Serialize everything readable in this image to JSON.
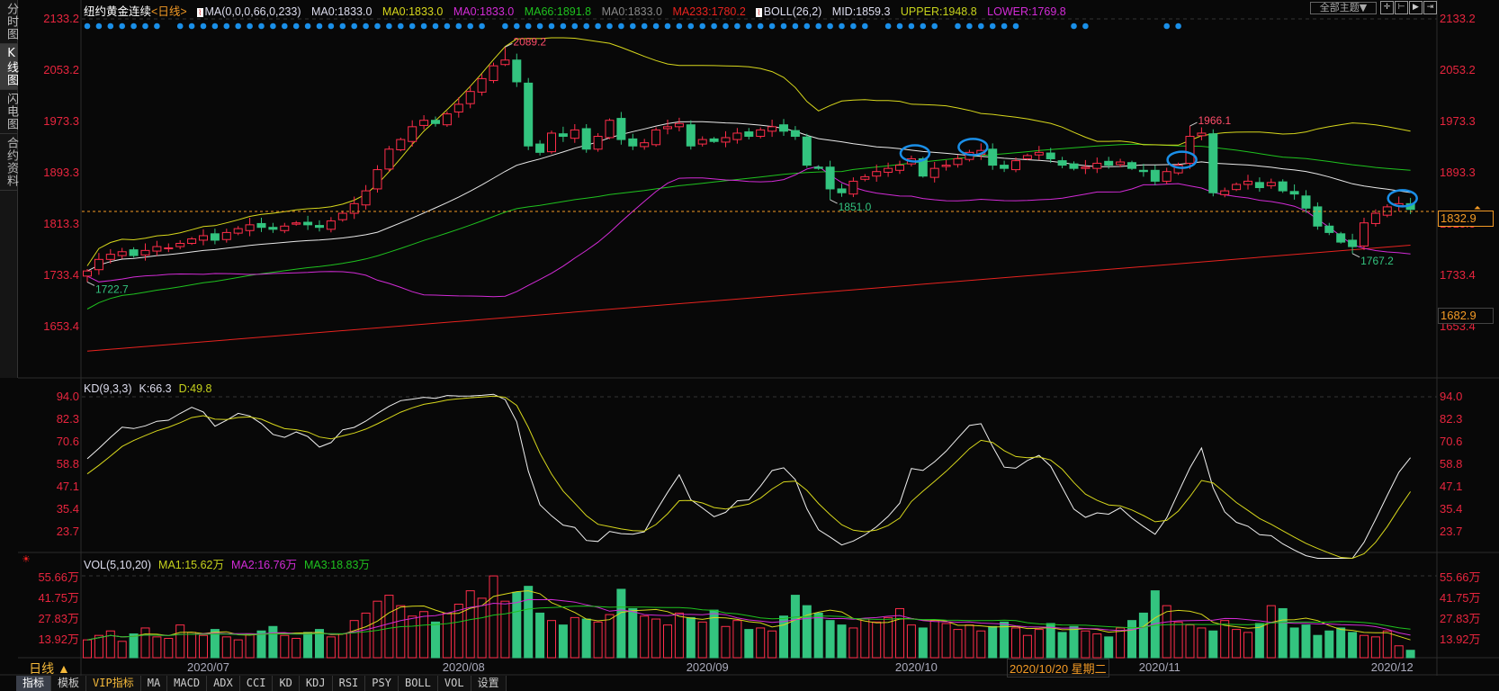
{
  "sidebar": {
    "tabs": [
      "分时图",
      "K线图",
      "闪电图",
      "合约资料"
    ],
    "active": 1
  },
  "header": {
    "title": "纽约黄金连续",
    "period": "<日线>",
    "ma_params": "MA(0,0,0,66,0,233)",
    "ma0_white": "MA0:1833.0",
    "ma0_yellow": "MA0:1833.0",
    "ma0_magenta": "MA0:1833.0",
    "ma66": "MA66:1891.8",
    "ma0_grey": "MA0:1833.0",
    "ma233": "MA233:1780.2",
    "boll": "BOLL(26,2)",
    "mid": "MID:1859.3",
    "upper": "UPPER:1948.8",
    "lower": "LOWER:1769.8"
  },
  "topright": {
    "theme_button": "全部主题▼"
  },
  "price_axis": {
    "labels": [
      "2133.2",
      "2053.2",
      "1973.3",
      "1893.3",
      "1813.3",
      "1733.4",
      "1653.4"
    ],
    "current_price": "1832.9",
    "cursor_price": "1682.9"
  },
  "kd": {
    "header": "KD(9,3,3)",
    "k": "K:66.3",
    "d": "D:49.8",
    "labels": [
      "94.0",
      "82.3",
      "70.6",
      "58.8",
      "47.1",
      "35.4",
      "23.7"
    ]
  },
  "vol": {
    "header": "VOL(5,10,20)",
    "ma1": "MA1:15.62万",
    "ma2": "MA2:16.76万",
    "ma3": "MA3:18.83万",
    "labels": [
      "55.66万",
      "41.75万",
      "27.83万",
      "13.92万"
    ]
  },
  "dates": {
    "labels": [
      "2020/07",
      "2020/08",
      "2020/09",
      "2020/10",
      "2020/11",
      "2020/12"
    ],
    "label_index": [
      10,
      32,
      53,
      71,
      92,
      112
    ],
    "cursor": "2020/10/20 星期二"
  },
  "bottom": {
    "period": "日线 ▲",
    "toolbar": [
      "指标",
      "模板",
      "VIP指标",
      "MA",
      "MACD",
      "ADX",
      "CCI",
      "KD",
      "KDJ",
      "RSI",
      "PSY",
      "BOLL",
      "VOL",
      "设置"
    ]
  },
  "colors": {
    "up": "#ff2d4a",
    "down": "#33c47f",
    "mid": "#e8e8e8",
    "upper": "#d7d71c",
    "lower": "#d22bd6",
    "ma66": "#1fc21f",
    "ma233": "#e8231f",
    "accent": "#f39a25",
    "marker": "#1a8fe8"
  },
  "chart_data": {
    "type": "candlestick",
    "first_open": 1732,
    "close": [
      1740,
      1758,
      1766,
      1770,
      1764,
      1772,
      1778,
      1776,
      1783,
      1790,
      1795,
      1788,
      1800,
      1806,
      1812,
      1808,
      1805,
      1810,
      1815,
      1812,
      1808,
      1818,
      1830,
      1845,
      1865,
      1898,
      1930,
      1945,
      1965,
      1975,
      1970,
      1985,
      2000,
      2020,
      2040,
      2060,
      2069,
      2035,
      1935,
      1925,
      1955,
      1950,
      1960,
      1930,
      1950,
      1975,
      1945,
      1935,
      1940,
      1960,
      1965,
      1970,
      1935,
      1945,
      1942,
      1948,
      1955,
      1950,
      1960,
      1965,
      1958,
      1950,
      1905,
      1900,
      1868,
      1862,
      1880,
      1887,
      1895,
      1900,
      1905,
      1915,
      1888,
      1900,
      1905,
      1915,
      1925,
      1928,
      1905,
      1900,
      1912,
      1920,
      1925,
      1915,
      1905,
      1900,
      1902,
      1908,
      1905,
      1910,
      1900,
      1895,
      1880,
      1895,
      1905,
      1950,
      1955,
      1862,
      1865,
      1875,
      1880,
      1870,
      1878,
      1865,
      1860,
      1838,
      1810,
      1800,
      1785,
      1778,
      1815,
      1830,
      1840,
      1845,
      1836
    ],
    "volume": [
      12,
      15,
      18,
      11,
      16,
      20,
      14,
      13,
      22,
      17,
      15,
      19,
      14,
      12,
      16,
      18,
      21,
      15,
      13,
      17,
      19,
      14,
      16,
      25,
      30,
      38,
      42,
      35,
      28,
      31,
      24,
      30,
      36,
      45,
      40,
      55,
      38,
      44,
      48,
      30,
      25,
      22,
      27,
      26,
      24,
      29,
      46,
      33,
      28,
      26,
      22,
      30,
      27,
      24,
      32,
      21,
      25,
      19,
      20,
      18,
      28,
      42,
      35,
      30,
      25,
      22,
      20,
      26,
      24,
      27,
      33,
      22,
      20,
      25,
      23,
      19,
      22,
      18,
      21,
      24,
      20,
      15,
      19,
      23,
      17,
      21,
      18,
      16,
      14,
      20,
      25,
      30,
      45,
      35,
      24,
      22,
      20,
      18,
      25,
      19,
      17,
      23,
      35,
      33,
      20,
      22,
      15,
      18,
      20,
      17,
      15,
      14,
      18,
      8,
      5
    ],
    "annotations": [
      {
        "index": 36,
        "type": "high",
        "value": 2089.2,
        "label": "2089.2"
      },
      {
        "index": 95,
        "type": "high",
        "value": 1966.1,
        "label": "1966.1"
      },
      {
        "index": 64,
        "type": "low",
        "value": 1851.0,
        "label": "1851.0"
      },
      {
        "index": 109,
        "type": "low",
        "value": 1767.2,
        "label": "1767.2"
      },
      {
        "index": 0,
        "type": "low",
        "value": 1722.7,
        "label": "1722.7"
      }
    ],
    "ma233_range": [
      1615,
      1780.2
    ],
    "signal_dot_indices": [
      0,
      1,
      2,
      3,
      4,
      5,
      6,
      8,
      9,
      10,
      11,
      12,
      13,
      14,
      15,
      16,
      17,
      18,
      19,
      20,
      21,
      22,
      23,
      24,
      25,
      26,
      27,
      28,
      29,
      30,
      31,
      32,
      33,
      34,
      36,
      37,
      38,
      39,
      40,
      41,
      42,
      43,
      44,
      45,
      46,
      47,
      48,
      49,
      50,
      51,
      52,
      53,
      54,
      55,
      56,
      57,
      58,
      59,
      60,
      61,
      62,
      63,
      64,
      65,
      66,
      67,
      69,
      70,
      71,
      72,
      73,
      75,
      76,
      77,
      78,
      79,
      80,
      85,
      86,
      93,
      94
    ],
    "circled_indices": [
      71,
      76,
      94,
      113
    ],
    "ylim": [
      1620,
      2140
    ]
  }
}
